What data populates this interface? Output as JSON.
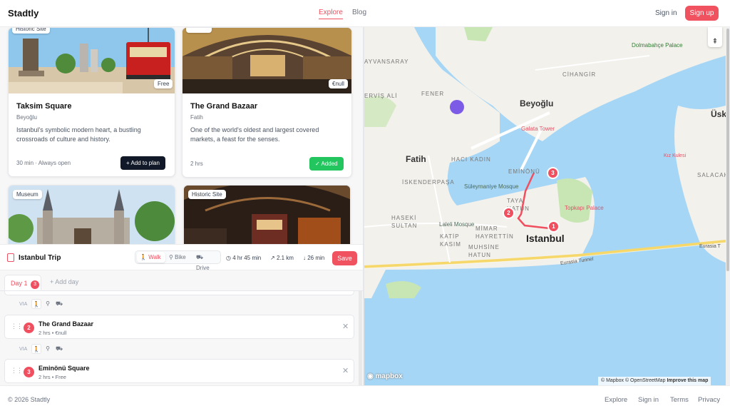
{
  "header": {
    "logo": "Stadtly",
    "nav": [
      "Explore",
      "Blog"
    ],
    "sign_in": "Sign in",
    "sign_up": "Sign up"
  },
  "cards": [
    {
      "badge": "Historic Site",
      "title": "Taksim Square",
      "district": "Beyoğlu",
      "description": "Istanbul's symbolic modern heart, a bustling crossroads of culture and history.",
      "price": "Free",
      "duration": "30 min",
      "hours": "Always open",
      "action": "+ Add to plan"
    },
    {
      "badge": "",
      "title": "The Grand Bazaar",
      "district": "Fatih",
      "description": "One of the world's oldest and largest covered markets, a feast for the senses.",
      "price": "€null",
      "duration": "2 hrs",
      "action": "✓ Added"
    },
    {
      "badge": "Museum"
    },
    {
      "badge": "Historic Site"
    }
  ],
  "plan": {
    "icon": "clipboard-icon",
    "title": "Istanbul Trip",
    "modes": [
      "Walk",
      "Bike",
      "Drive"
    ],
    "active_mode": "Walk",
    "total_time": "4 hr 45 min",
    "distance": "2.1 km",
    "walk_time": "26 min",
    "save": "Save"
  },
  "days": {
    "active": "Day 1",
    "count": "3",
    "add": "Add day"
  },
  "stops": [
    {
      "num": "2",
      "name": "The Grand Bazaar",
      "duration": "2 hrs",
      "price": "€null"
    },
    {
      "num": "3",
      "name": "Eminönü Square",
      "duration": "2 hrs",
      "price": "Free"
    }
  ],
  "via": "VIA",
  "map": {
    "labels": {
      "beyoglu": "Beyoğlu",
      "fatih": "Fatih",
      "istanbul": "Istanbul",
      "uskudar": "Üsk",
      "aksaray": "AYVANSARAY",
      "cihangir": "CİHANGİR",
      "fener": "FENER",
      "ervis": "ERVİŞ ALİ",
      "haci": "HACI KADIN",
      "iskender": "İSKENDERPAŞA",
      "haseki": "HASEKİ SULTAN",
      "katip": "KATİP KASIM",
      "mimar": "MİMAR HAYRETTİN",
      "muhsine": "MUHSİNE HATUN",
      "eminonu": "EMİNÖNÜ",
      "tayahatun": "TAYA HATUN",
      "salacak": "SALACAK",
      "dolmabahce": "Dolmabahçe Palace",
      "galata": "Galata Tower",
      "suleymaniye": "Süleymaniye Mosque",
      "laleli": "Laleli Mosque",
      "topkapi": "Topkapı Palace",
      "kizkulesi": "Kız Kulesi",
      "eurasia": "Eurasia Tunnel",
      "eurasia2": "Eurasia T"
    },
    "markers": [
      "1",
      "2",
      "3"
    ],
    "attribution": "© Mapbox © OpenStreetMap",
    "improve": "Improve this map",
    "mapbox": "mapbox",
    "colors": {
      "water": "#a6d6f5",
      "land": "#f3f1ec",
      "park": "#c8e6b4",
      "route": "#ef4f5f"
    }
  },
  "footer": {
    "copyright": "© 2026 Stadtly",
    "links": [
      "Explore",
      "Sign in",
      "Terms",
      "Privacy"
    ]
  }
}
